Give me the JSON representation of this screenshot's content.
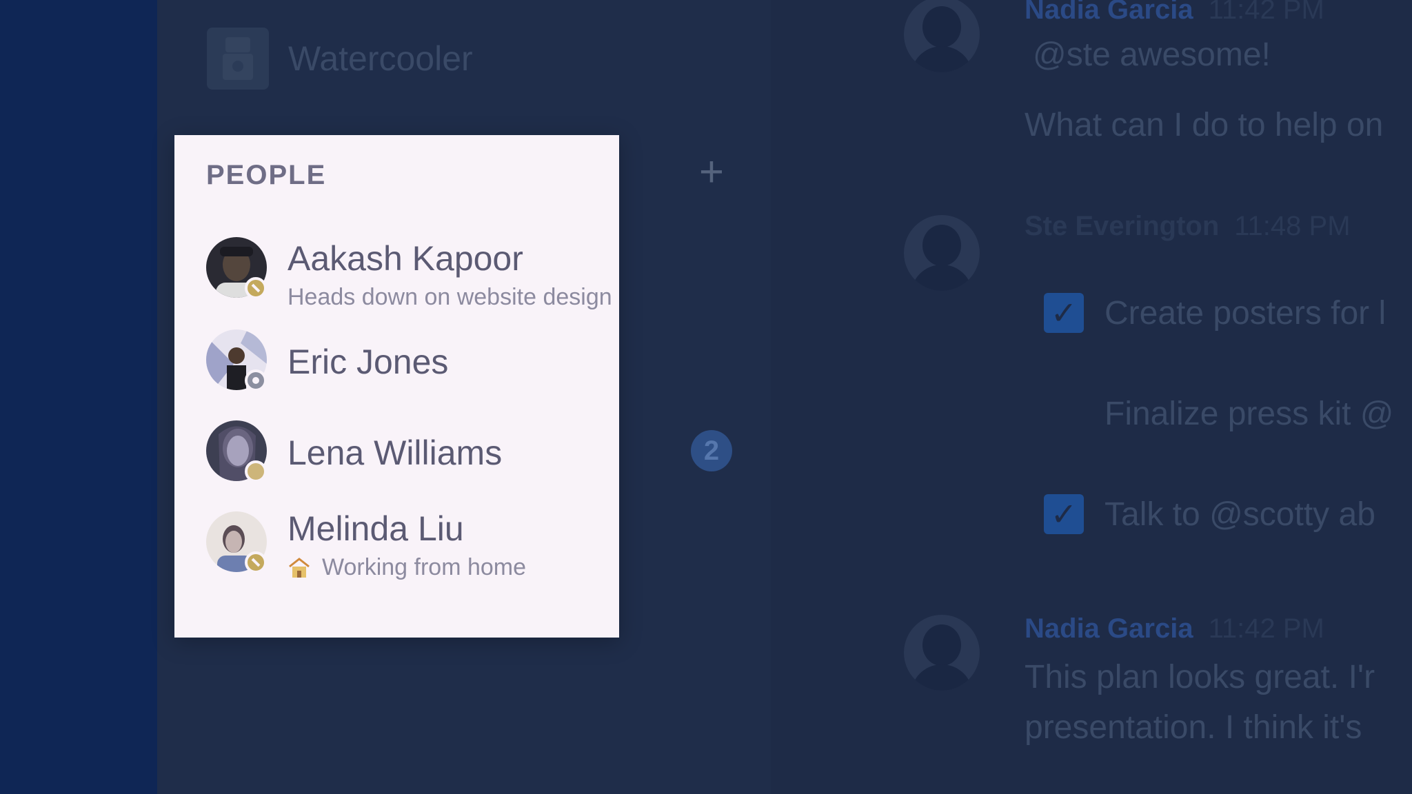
{
  "room": {
    "name": "Watercooler"
  },
  "sidebar": {
    "add_label": "+",
    "unread_count": "2"
  },
  "people": {
    "title": "PEOPLE",
    "items": [
      {
        "name": "Aakash Kapoor",
        "status_text": "Heads down on website design",
        "presence": "busy"
      },
      {
        "name": "Eric Jones",
        "status_text": "",
        "presence": "offline"
      },
      {
        "name": "Lena Williams",
        "status_text": "",
        "presence": "available"
      },
      {
        "name": "Melinda Liu",
        "status_text": "Working from home",
        "status_icon": "house-icon",
        "presence": "busy"
      }
    ]
  },
  "chat": {
    "messages": [
      {
        "author": "Nadia Garcia",
        "time": "11:42 PM",
        "lines": [
          "@ste  awesome!",
          "What can I do to help on"
        ]
      },
      {
        "author": "Ste Everington",
        "time": "11:48 PM",
        "tasks": [
          {
            "text": "Create posters for l",
            "checked": "true"
          },
          {
            "text": "Finalize press kit @",
            "checked": "false"
          },
          {
            "text": "Talk to @scotty  ab",
            "checked": "true"
          }
        ]
      },
      {
        "author": "Nadia Garcia",
        "time": "11:42 PM",
        "lines": [
          "This plan looks great. I'r",
          "presentation. I think it's"
        ]
      }
    ]
  },
  "colors": {
    "rail": "#0f2655",
    "sidebar": "#1f2d4a",
    "card_bg": "#f9f3f9",
    "busy": "#c4a95d",
    "checkbox": "#1f4e93"
  }
}
